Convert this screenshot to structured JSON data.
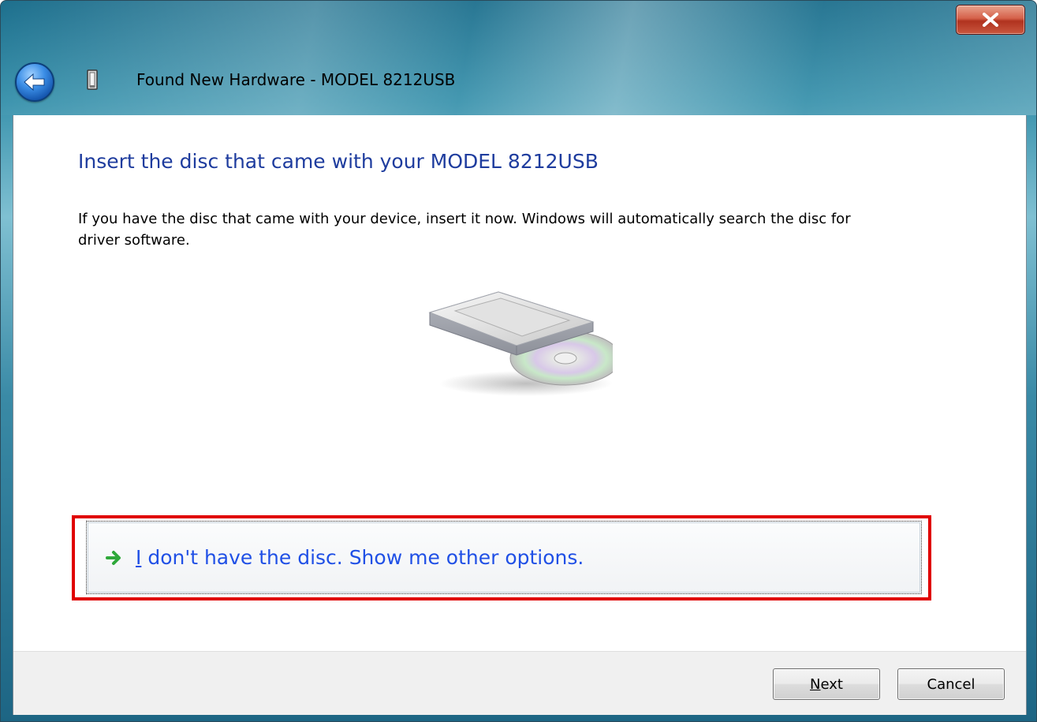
{
  "window": {
    "title": "Found New Hardware - MODEL 8212USB",
    "close_label": "x"
  },
  "content": {
    "heading": "Insert the disc that came with your MODEL 8212USB",
    "description": "If you have the disc that came with your device, insert it now.  Windows will automatically search the disc for driver software."
  },
  "command_link": {
    "label_first": "I",
    "label_rest": " don't have the disc.  Show me other options.",
    "highlight_color": "#e00000",
    "text_color": "#2050e6"
  },
  "footer": {
    "next_first": "N",
    "next_rest": "ext",
    "cancel_label": "Cancel"
  },
  "icons": {
    "back": "back-arrow-icon",
    "device": "usb-device-icon",
    "disc": "disc-drive-icon",
    "link_arrow": "green-arrow-icon",
    "close": "close-icon"
  },
  "colors": {
    "heading": "#1e3c9e",
    "titlebar": "#3b93ad",
    "close_button": "#c9573e"
  }
}
